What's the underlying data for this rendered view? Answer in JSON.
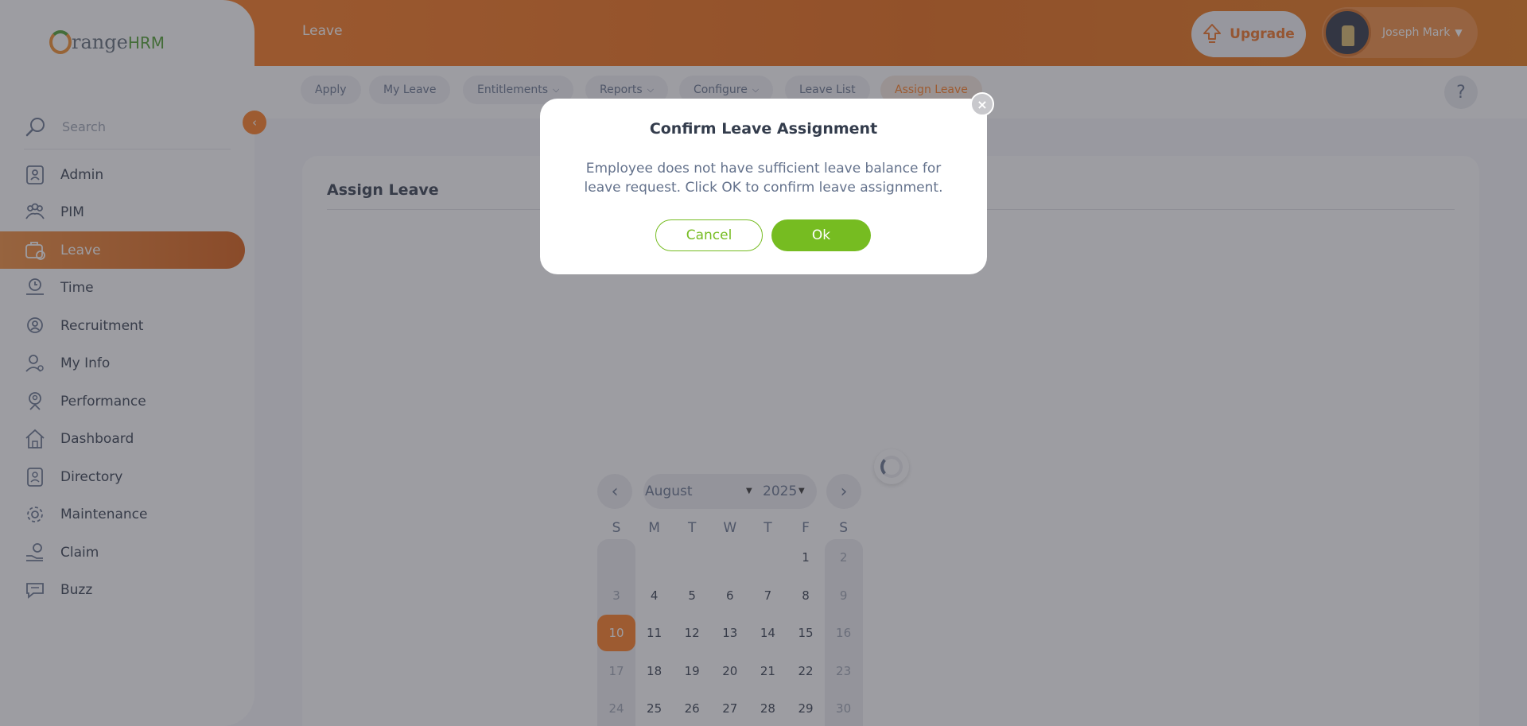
{
  "topbar": {
    "title": "Leave",
    "upgrade_label": "Upgrade",
    "user_name": "Joseph Mark"
  },
  "subnav": {
    "items": [
      {
        "label": "Apply"
      },
      {
        "label": "My Leave"
      },
      {
        "label": "Entitlements"
      },
      {
        "label": "Reports"
      },
      {
        "label": "Configure"
      },
      {
        "label": "Leave List"
      },
      {
        "label": "Assign Leave"
      }
    ],
    "help": "?"
  },
  "sidebar": {
    "brand": {
      "o": "O",
      "range": "range",
      "hrm": "HRM"
    },
    "search_placeholder": "Search",
    "items": [
      {
        "label": "Admin",
        "icon": "admin-icon"
      },
      {
        "label": "PIM",
        "icon": "pim-icon"
      },
      {
        "label": "Leave",
        "icon": "leave-icon",
        "active": true
      },
      {
        "label": "Time",
        "icon": "time-icon"
      },
      {
        "label": "Recruitment",
        "icon": "recruitment-icon"
      },
      {
        "label": "My Info",
        "icon": "my-info-icon"
      },
      {
        "label": "Performance",
        "icon": "performance-icon"
      },
      {
        "label": "Dashboard",
        "icon": "dashboard-icon"
      },
      {
        "label": "Directory",
        "icon": "directory-icon"
      },
      {
        "label": "Maintenance",
        "icon": "maintenance-icon"
      },
      {
        "label": "Claim",
        "icon": "claim-icon"
      },
      {
        "label": "Buzz",
        "icon": "buzz-icon"
      }
    ]
  },
  "main": {
    "card_title": "Assign Leave"
  },
  "calendar": {
    "month": "August",
    "year": "2025",
    "weekdays": [
      "S",
      "M",
      "T",
      "W",
      "T",
      "F",
      "S"
    ],
    "selected_day": "10",
    "weeks": [
      [
        "",
        "",
        "",
        "",
        "",
        "1",
        "2"
      ],
      [
        "3",
        "4",
        "5",
        "6",
        "7",
        "8",
        "9"
      ],
      [
        "10",
        "11",
        "12",
        "13",
        "14",
        "15",
        "16"
      ],
      [
        "17",
        "18",
        "19",
        "20",
        "21",
        "22",
        "23"
      ],
      [
        "24",
        "25",
        "26",
        "27",
        "28",
        "29",
        "30"
      ]
    ]
  },
  "modal": {
    "title": "Confirm Leave Assignment",
    "body": "Employee does not have sufficient leave balance for leave request. Click OK to confirm leave assignment.",
    "cancel_label": "Cancel",
    "ok_label": "Ok",
    "close": "×"
  },
  "colors": {
    "brand_orange": "#ff7b1d",
    "ok_green": "#76bc21",
    "text": "#64728c"
  }
}
